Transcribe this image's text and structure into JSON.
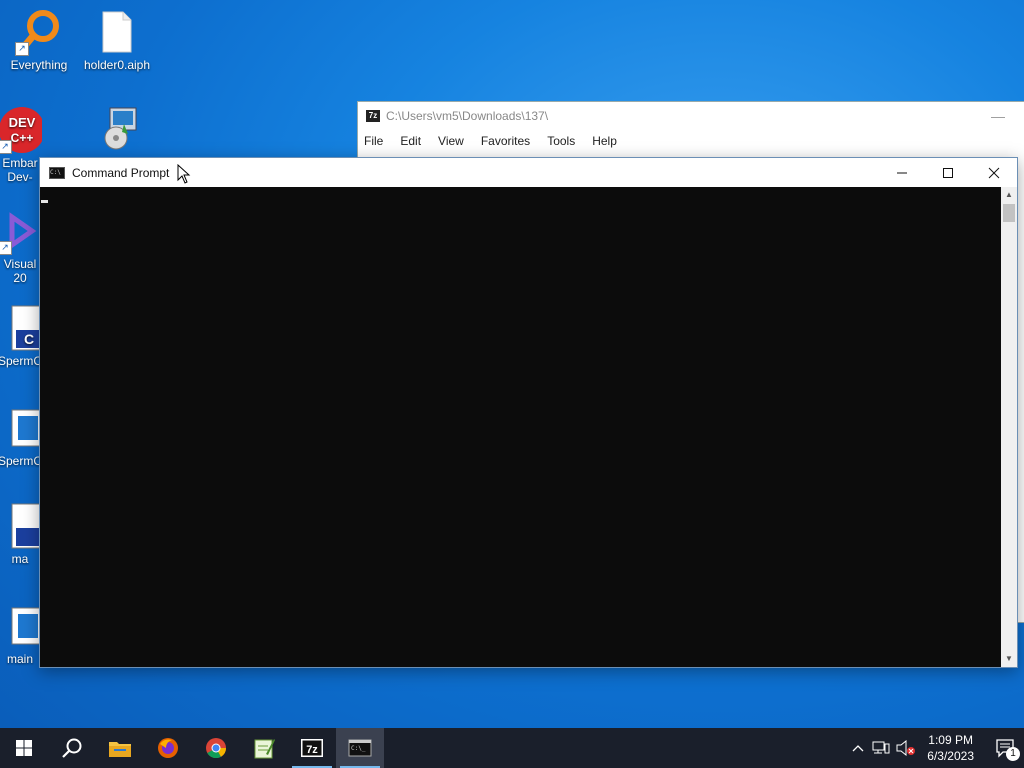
{
  "desktop": {
    "icons": [
      {
        "label": "Everything"
      },
      {
        "label": "holder0.aiph"
      },
      {
        "label": "Embar Dev-"
      },
      {
        "label": ""
      },
      {
        "label": "Visual 20"
      },
      {
        "label": "SpermC"
      },
      {
        "label": "SpermC"
      },
      {
        "label": "ma"
      },
      {
        "label": "main"
      }
    ]
  },
  "win7z": {
    "title": "C:\\Users\\vm5\\Downloads\\137\\",
    "menu": [
      "File",
      "Edit",
      "View",
      "Favorites",
      "Tools",
      "Help"
    ]
  },
  "cmd": {
    "title": "Command Prompt"
  },
  "taskbar": {
    "time": "1:09 PM",
    "date": "6/3/2023",
    "notification_count": "1"
  },
  "colors": {
    "accent": "#76b9ed",
    "console_bg": "#0c0c0c",
    "desktop_bg": "#1683e0"
  }
}
